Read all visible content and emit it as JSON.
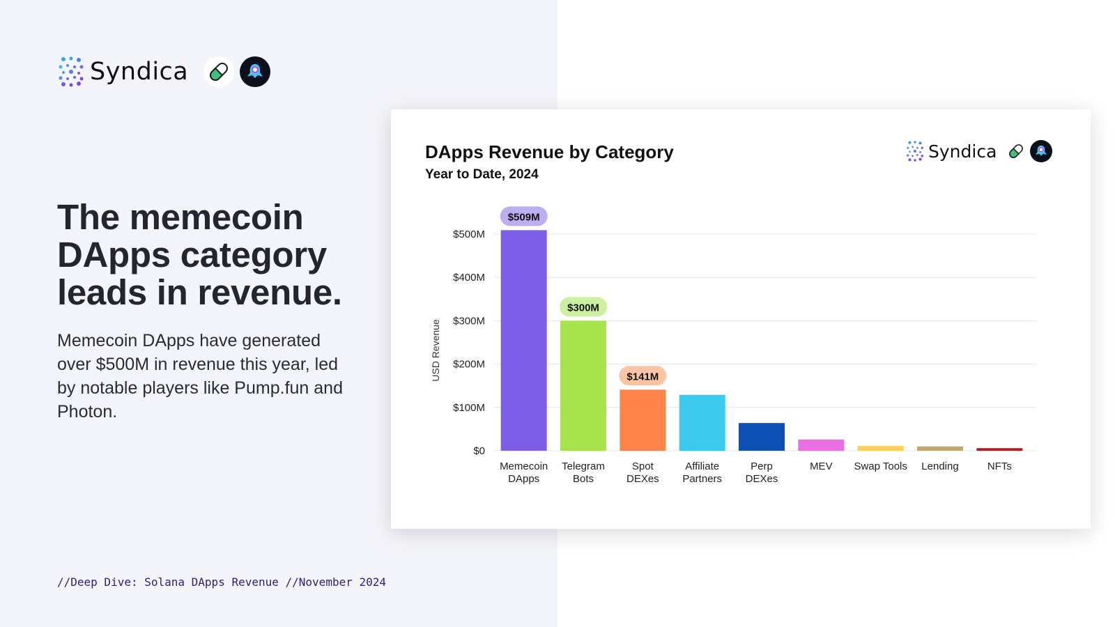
{
  "brand": {
    "name": "Syndica",
    "icons": [
      "syndica-logo-icon",
      "pill-icon",
      "rocket-icon"
    ]
  },
  "headline": "The memecoin DApps category leads in revenue.",
  "body": "Memecoin DApps have generated over $500M in revenue this year, led by notable players like Pump.fun and Photon.",
  "footer": "//Deep Dive: Solana DApps Revenue //November 2024",
  "colors": {
    "left_background": "#f4f5fa",
    "footer_text": "#2c1e78"
  },
  "chart_data": {
    "type": "bar",
    "title": "DApps Revenue by Category",
    "subtitle": "Year to Date, 2024",
    "xlabel": "",
    "ylabel": "USD Revenue",
    "ylim": [
      0,
      500
    ],
    "y_ticks": [
      0,
      100,
      200,
      300,
      400,
      500
    ],
    "y_tick_labels": [
      "$0",
      "$100M",
      "$200M",
      "$300M",
      "$400M",
      "$500M"
    ],
    "grid": true,
    "categories": [
      "Memecoin DApps",
      "Telegram Bots",
      "Spot DEXes",
      "Affiliate Partners",
      "Perp DEXes",
      "MEV",
      "Swap Tools",
      "Lending",
      "NFTs"
    ],
    "category_lines": [
      [
        "Memecoin",
        "DApps"
      ],
      [
        "Telegram",
        "Bots"
      ],
      [
        "Spot",
        "DEXes"
      ],
      [
        "Affiliate",
        "Partners"
      ],
      [
        "Perp",
        "DEXes"
      ],
      [
        "MEV"
      ],
      [
        "Swap Tools"
      ],
      [
        "Lending"
      ],
      [
        "NFTs"
      ]
    ],
    "values": [
      509,
      300,
      141,
      129,
      64,
      26,
      11,
      10,
      6
    ],
    "units": "USD millions",
    "colors": [
      "#7b5fe6",
      "#a8e34d",
      "#fd844a",
      "#3ccbee",
      "#0e4fb3",
      "#eb6ee0",
      "#fbcf5a",
      "#c1a86f",
      "#b71c1c"
    ],
    "data_labels": [
      {
        "index": 0,
        "text": "$509M",
        "bg": "#bcaef0"
      },
      {
        "index": 1,
        "text": "$300M",
        "bg": "#cdf0a0"
      },
      {
        "index": 2,
        "text": "$141M",
        "bg": "#fbc4a4"
      }
    ]
  }
}
